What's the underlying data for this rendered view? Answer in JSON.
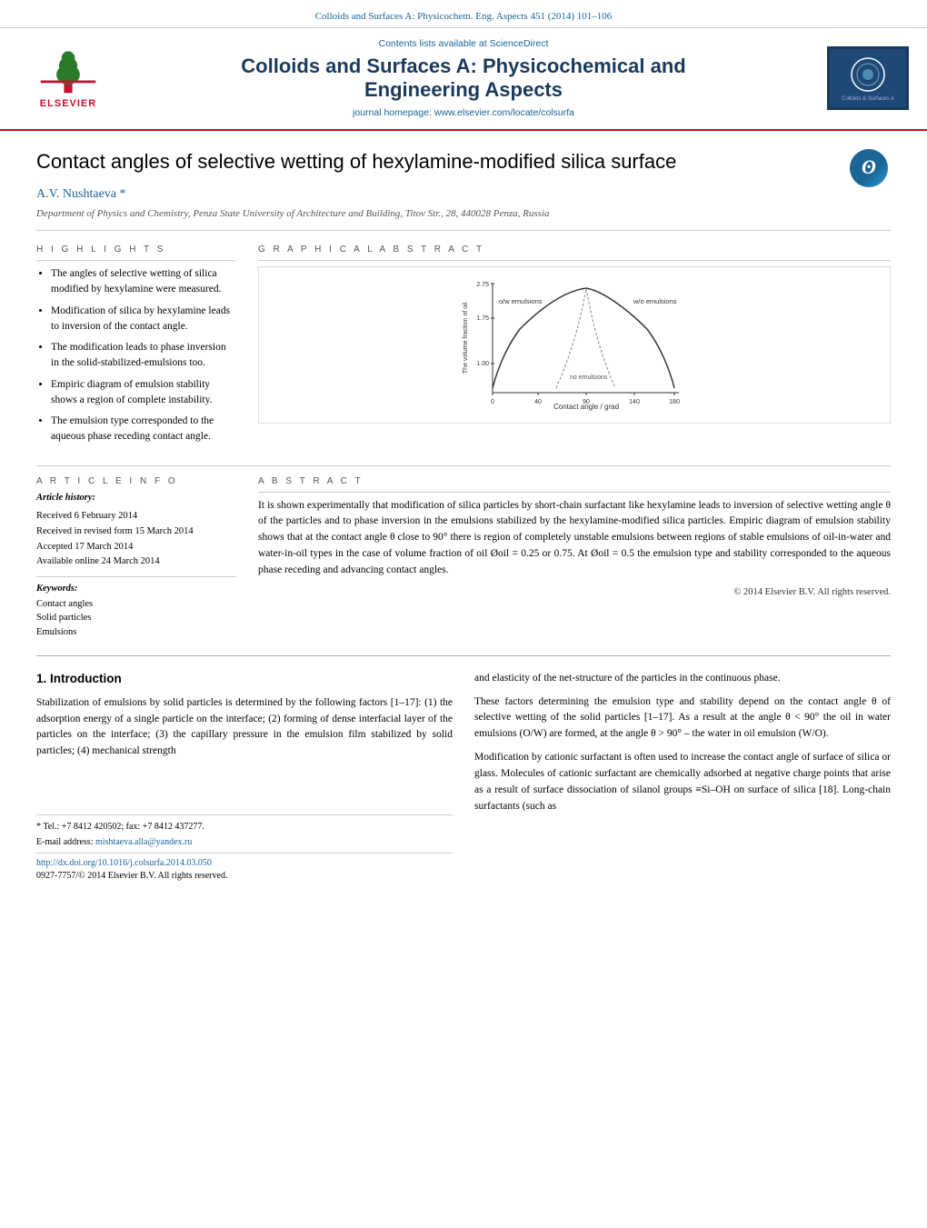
{
  "header": {
    "journal_link_text": "Colloids and Surfaces A: Physicochem. Eng. Aspects 451 (2014) 101–106",
    "contents_text": "Contents lists available at",
    "science_direct": "ScienceDirect",
    "journal_title_line1": "Colloids and Surfaces A: Physicochemical and",
    "journal_title_line2": "Engineering Aspects",
    "homepage_text": "journal homepage:",
    "homepage_url": "www.elsevier.com/locate/colsurfa",
    "elsevier_text": "ELSEVIER"
  },
  "article": {
    "title": "Contact angles of selective wetting of hexylamine-modified silica surface",
    "authors": "A.V. Nushtaeva *",
    "affiliation": "Department of Physics and Chemistry, Penza State University of Architecture and Building, Titov Str., 28, 440028 Penza, Russia"
  },
  "highlights": {
    "header": "H I G H L I G H T S",
    "items": [
      "The angles of selective wetting of silica modified by hexylamine were measured.",
      "Modification of silica by hexylamine leads to inversion of the contact angle.",
      "The modification leads to phase inversion in the solid-stabilized-emulsions too.",
      "Empiric diagram of emulsion stability shows a region of complete instability.",
      "The emulsion type corresponded to the aqueous phase receding contact angle."
    ]
  },
  "graphical_abstract": {
    "header": "G R A P H I C A L   A B S T R A C T"
  },
  "article_info": {
    "header": "A R T I C L E   I N F O",
    "history_label": "Article history:",
    "history_items": [
      "Received 6 February 2014",
      "Received in revised form 15 March 2014",
      "Accepted 17 March 2014",
      "Available online 24 March 2014"
    ],
    "keywords_label": "Keywords:",
    "keywords": [
      "Contact angles",
      "Solid particles",
      "Emulsions"
    ]
  },
  "abstract": {
    "header": "A B S T R A C T",
    "text": "It is shown experimentally that modification of silica particles by short-chain surfactant like hexylamine leads to inversion of selective wetting angle θ of the particles and to phase inversion in the emulsions stabilized by the hexylamine-modified silica particles. Empiric diagram of emulsion stability shows that at the contact angle θ close to 90° there is region of completely unstable emulsions between regions of stable emulsions of oil-in-water and water-in-oil types in the case of volume fraction of oil Øoil = 0.25 or 0.75. At Øoil = 0.5 the emulsion type and stability corresponded to the aqueous phase receding and advancing contact angles.",
    "copyright": "© 2014 Elsevier B.V. All rights reserved."
  },
  "introduction": {
    "section_number": "1.",
    "section_title": "Introduction",
    "left_text_1": "Stabilization of emulsions by solid particles is determined by the following factors [1–17]: (1) the adsorption energy of a single particle on the interface; (2) forming of dense interfacial layer of the particles on the interface; (3) the capillary pressure in the emulsion film stabilized by solid particles; (4) mechanical strength",
    "right_text_1": "and elasticity of the net-structure of the particles in the continuous phase.",
    "right_text_2": "These factors determining the emulsion type and stability depend on the contact angle θ of selective wetting of the solid particles [1–17]. As a result at the angle θ < 90° the oil in water emulsions (O/W) are formed, at the angle θ > 90° – the water in oil emulsion (W/O).",
    "right_text_3": "Modification by cationic surfactant is often used to increase the contact angle of surface of silica or glass. Molecules of cationic surfactant are chemically adsorbed at negative charge points that arise as a result of surface dissociation of silanol groups ≡Si–OH on surface of silica [18]. Long-chain surfactants (such as"
  },
  "footnotes": {
    "star_note": "* Tel.: +7 8412 420502; fax: +7 8412 437277.",
    "email_label": "E-mail address:",
    "email": "mishtaeva.alla@yandex.ru",
    "doi_text": "http://dx.doi.org/10.1016/j.colsurfa.2014.03.050",
    "issn_text": "0927-7757/© 2014 Elsevier B.V. All rights reserved."
  },
  "graph": {
    "y_axis_label": "The volume fraction of oil",
    "x_axis_label": "Contact angle / grad",
    "curve_labels": [
      "w/o emulsions",
      "o/w emulsions",
      "no emulsions"
    ],
    "y_max": "2.75",
    "y_mid": "1.75",
    "y_low": "1.00",
    "x_values": [
      "0",
      "40",
      "90",
      "140",
      "180"
    ]
  }
}
